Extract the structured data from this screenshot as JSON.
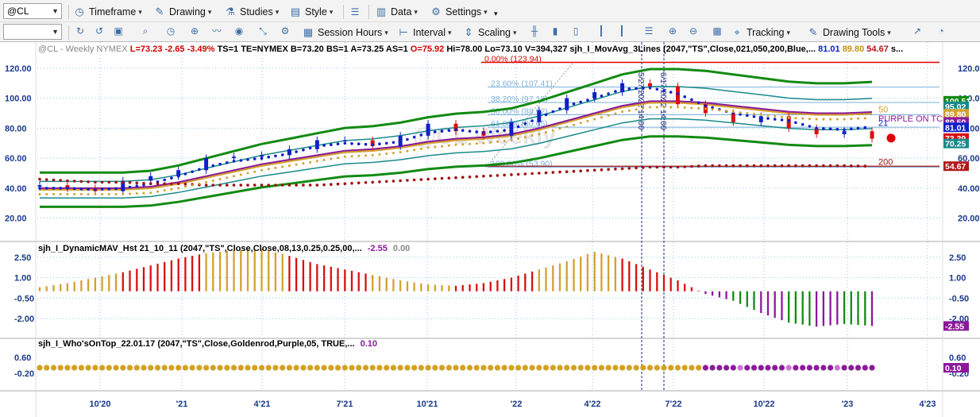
{
  "symbol_box": "@CL",
  "toolbar1": {
    "timeframe": "Timeframe",
    "drawing": "Drawing",
    "studies": "Studies",
    "style": "Style",
    "data": "Data",
    "settings": "Settings"
  },
  "toolbar2": {
    "session_hours": "Session Hours",
    "interval": "Interval",
    "scaling": "Scaling",
    "tracking": "Tracking",
    "drawing_tools": "Drawing Tools"
  },
  "colors": {
    "up": "#1020c8",
    "down": "#d81010",
    "green_band": "#128a12",
    "teal_band": "#1a8a8a",
    "gold": "#d4a030",
    "purple": "#8b1a9a",
    "fib": "#7ab0d8",
    "red_line": "#e00000",
    "grid": "#9dc3e6"
  },
  "main_pane": {
    "header": {
      "symbol": "@CL - Weekly",
      "exchange": "NYMEX",
      "last": "L=73.23",
      "chg": "-2.65",
      "pct": "-3.49%",
      "ts": "TS=1",
      "te": "TE=NYMEX",
      "bid": "B=73.20",
      "bs": "BS=1",
      "ask": "A=73.25",
      "as": "AS=1",
      "open": "O=75.92",
      "hi": "Hi=78.00",
      "lo": "Lo=73.10",
      "vol": "V=394,327",
      "study": "sjh_I_MovAvg_3Lines (2047,\"TS\",Close,021,050,200,Blue,...",
      "v1": "81.01",
      "v2": "89.80",
      "v3": "54.67",
      "more": "s..."
    },
    "watermark": "@CL Weekly",
    "y_ticks": [
      "120.00",
      "100.00",
      "80.00",
      "60.00",
      "40.00",
      "20.00"
    ],
    "fib_labels": [
      "0.00% (123.94)",
      "23.60% (107.41)",
      "38.20% (97.18)",
      "50.00% (88.92)",
      "61.80% (80.65)",
      "100.00% (53.90)"
    ],
    "ma_labels": {
      "fifty": "50",
      "twentyone": "21",
      "twohundred": "200",
      "purple_on_top": "PURPLE ON TC"
    },
    "right_tags": [
      {
        "text": "100.51",
        "color": "#128a12"
      },
      {
        "text": "95.02",
        "color": "#1a8a8a"
      },
      {
        "text": "89.80",
        "color": "#d4a030"
      },
      {
        "text": "89.50",
        "color": "#8b1a9a"
      },
      {
        "text": "81.01",
        "color": "#1020c8"
      },
      {
        "text": "73.39",
        "color": "#d81010"
      },
      {
        "text": "70.25",
        "color": "#1a8a8a"
      },
      {
        "text": "54.67",
        "color": "#b01818"
      }
    ],
    "vertical_dates": [
      "5/27/2022 14:00",
      "6/17/2022 14:00"
    ]
  },
  "pane2": {
    "header": "sjh_I_DynamicMAV_Hst 21_10_11 (2047,\"TS\",Close,Close,08,13,0.25,0.25,00,...",
    "v1": "-2.55",
    "v2": "0.00",
    "y_ticks": [
      "2.50",
      "1.00",
      "-0.50",
      "-2.00"
    ],
    "tag": "-2.55"
  },
  "pane3": {
    "header": "sjh_I_Who'sOnTop_22.01.17 (2047,\"TS\",Close,Goldenrod,Purple,05, TRUE,...",
    "v1": "0.10",
    "y_ticks": [
      "0.60",
      "-0.20"
    ],
    "tag": "0.10"
  },
  "x_ticks": [
    "10'20",
    "'21",
    "4'21",
    "7'21",
    "10'21",
    "'22",
    "4'22",
    "7'22",
    "10'22",
    "'23",
    "4'23"
  ],
  "chart_data": {
    "type": "line",
    "title": "@CL - Weekly NYMEX",
    "ylim": [
      5,
      130
    ],
    "x": [
      "2020-08",
      "2020-09",
      "2020-10",
      "2020-11",
      "2020-12",
      "2021-01",
      "2021-02",
      "2021-03",
      "2021-04",
      "2021-05",
      "2021-06",
      "2021-07",
      "2021-08",
      "2021-09",
      "2021-10",
      "2021-11",
      "2021-12",
      "2022-01",
      "2022-02",
      "2022-03",
      "2022-04",
      "2022-05",
      "2022-06",
      "2022-07",
      "2022-08",
      "2022-09",
      "2022-10",
      "2022-11",
      "2022-12",
      "2023-01",
      "2023-02"
    ],
    "series": [
      {
        "name": "Close",
        "values": [
          42,
          40,
          38,
          45,
          48,
          52,
          60,
          61,
          62,
          66,
          72,
          72,
          68,
          75,
          83,
          78,
          75,
          84,
          92,
          100,
          104,
          110,
          108,
          96,
          90,
          84,
          88,
          80,
          76,
          78,
          73
        ]
      },
      {
        "name": "21",
        "values": [
          40,
          40,
          39,
          40,
          43,
          48,
          54,
          58,
          60,
          63,
          68,
          70,
          69,
          71,
          77,
          79,
          77,
          79,
          87,
          95,
          100,
          106,
          107,
          103,
          95,
          90,
          87,
          85,
          80,
          79,
          81
        ]
      },
      {
        "name": "50",
        "values": [
          39,
          39,
          39,
          39,
          40,
          43,
          47,
          51,
          55,
          58,
          61,
          64,
          65,
          67,
          70,
          72,
          73,
          75,
          79,
          84,
          89,
          94,
          97,
          97,
          96,
          94,
          92,
          90,
          89,
          89,
          89.8
        ]
      },
      {
        "name": "200",
        "values": [
          46,
          45,
          44,
          44,
          43,
          43,
          42,
          42,
          42,
          42,
          42,
          43,
          44,
          45,
          46,
          47,
          48,
          49,
          50,
          51,
          52,
          53,
          54,
          54,
          55,
          55,
          55,
          55,
          55,
          55,
          54.67
        ]
      }
    ],
    "pane2_histogram": [
      0.3,
      0.6,
      1.0,
      1.4,
      1.9,
      2.4,
      2.8,
      3.0,
      3.1,
      2.6,
      2.0,
      1.6,
      1.2,
      0.8,
      0.5,
      0.4,
      0.6,
      1.0,
      1.6,
      2.2,
      2.9,
      2.4,
      1.6,
      0.8,
      -0.2,
      -0.7,
      -1.6,
      -2.3,
      -2.6,
      -2.4,
      -2.55
    ],
    "pane3_state": [
      "gold",
      "gold",
      "gold",
      "gold",
      "gold",
      "gold",
      "gold",
      "gold",
      "gold",
      "gold",
      "gold",
      "gold",
      "gold",
      "gold",
      "gold",
      "gold",
      "gold",
      "gold",
      "gold",
      "gold",
      "gold",
      "gold",
      "gold",
      "gold",
      "purple",
      "purple",
      "purple",
      "purple",
      "purple",
      "purple",
      "purple"
    ]
  }
}
